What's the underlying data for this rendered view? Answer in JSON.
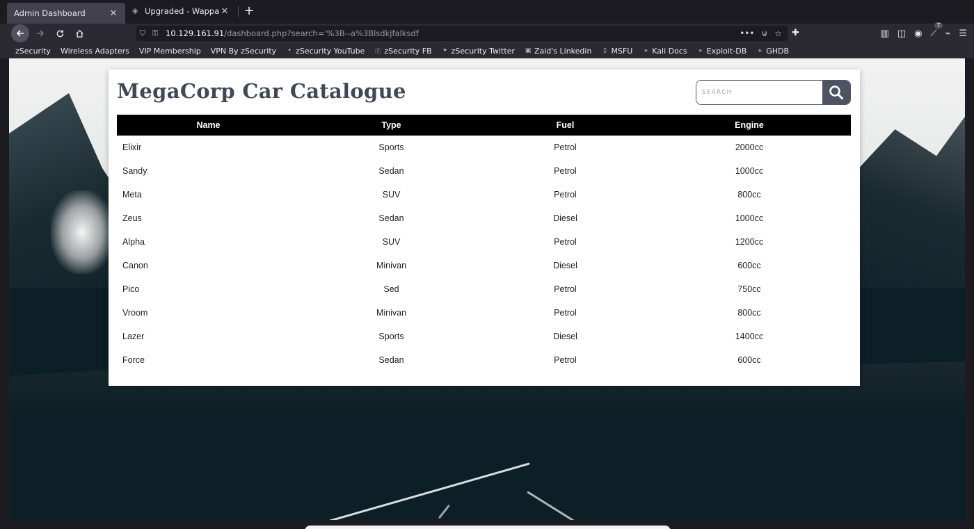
{
  "browser": {
    "tabs": [
      {
        "label": "Admin Dashboard",
        "active": true
      },
      {
        "label": "Upgraded - Wappalyzer",
        "active": false
      }
    ],
    "new_tab": "+",
    "url": {
      "host": "10.129.161.91",
      "path": "/dashboard.php?search='%3B--a%3Blsdkjfalksdf"
    },
    "reader_count": "7",
    "bookmarks": [
      {
        "label": "zSecurity",
        "icon": "folder-icon"
      },
      {
        "label": "Wireless Adapters",
        "icon": "bookmark-icon"
      },
      {
        "label": "VIP Membership",
        "icon": "bookmark-icon"
      },
      {
        "label": "VPN By zSecurity",
        "icon": "bookmark-icon"
      },
      {
        "label": "zSecurity YouTube",
        "icon": "youtube-icon"
      },
      {
        "label": "zSecurity FB",
        "icon": "facebook-icon"
      },
      {
        "label": "zSecurity Twitter",
        "icon": "twitter-icon"
      },
      {
        "label": "Zaid's Linkedin",
        "icon": "linkedin-icon"
      },
      {
        "label": "MSFU",
        "icon": "bookmark-icon"
      },
      {
        "label": "Kali Docs",
        "icon": "kali-icon"
      },
      {
        "label": "Exploit-DB",
        "icon": "exploit-db-icon"
      },
      {
        "label": "GHDB",
        "icon": "ghdb-icon"
      }
    ]
  },
  "page": {
    "title": "MegaCorp Car Catalogue",
    "search": {
      "placeholder": "SEARCH",
      "value": ""
    },
    "table": {
      "headers": [
        "Name",
        "Type",
        "Fuel",
        "Engine"
      ],
      "rows": [
        [
          "Elixir",
          "Sports",
          "Petrol",
          "2000cc"
        ],
        [
          "Sandy",
          "Sedan",
          "Petrol",
          "1000cc"
        ],
        [
          "Meta",
          "SUV",
          "Petrol",
          "800cc"
        ],
        [
          "Zeus",
          "Sedan",
          "Diesel",
          "1000cc"
        ],
        [
          "Alpha",
          "SUV",
          "Petrol",
          "1200cc"
        ],
        [
          "Canon",
          "Minivan",
          "Diesel",
          "600cc"
        ],
        [
          "Pico",
          "Sed",
          "Petrol",
          "750cc"
        ],
        [
          "Vroom",
          "Minivan",
          "Petrol",
          "800cc"
        ],
        [
          "Lazer",
          "Sports",
          "Diesel",
          "1400cc"
        ],
        [
          "Force",
          "Sedan",
          "Petrol",
          "600cc"
        ]
      ]
    }
  },
  "colors": {
    "header_bg": "#000000",
    "search_button": "#4e5362",
    "title": "#404855"
  }
}
